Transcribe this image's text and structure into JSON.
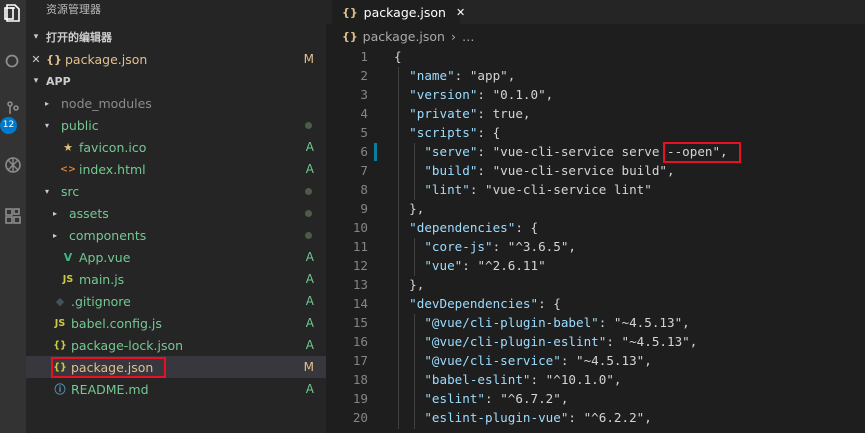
{
  "explorer": {
    "title": "资源管理器",
    "open_editors": {
      "header": "打开的编辑器",
      "items": [
        {
          "name": "package.json",
          "status": "M",
          "close_glyph": "✕",
          "icon": "braces-icon"
        }
      ]
    },
    "folder": {
      "header": "APP",
      "items": [
        {
          "name": "node_modules",
          "icon": "",
          "twisty": "▸",
          "status": "",
          "indent": 1
        },
        {
          "name": "public",
          "icon": "",
          "twisty": "▾",
          "status": "dot",
          "indent": 1
        },
        {
          "name": "favicon.ico",
          "icon": "★",
          "twisty": "",
          "status": "A",
          "indent": 2
        },
        {
          "name": "index.html",
          "icon": "<>",
          "twisty": "",
          "status": "A",
          "indent": 2
        },
        {
          "name": "src",
          "icon": "",
          "twisty": "▾",
          "status": "dot",
          "indent": 1
        },
        {
          "name": "assets",
          "icon": "",
          "twisty": "▸",
          "status": "dot",
          "indent": 2
        },
        {
          "name": "components",
          "icon": "",
          "twisty": "▸",
          "status": "dot",
          "indent": 2
        },
        {
          "name": "App.vue",
          "icon": "V",
          "twisty": "",
          "status": "A",
          "indent": 2
        },
        {
          "name": "main.js",
          "icon": "JS",
          "twisty": "",
          "status": "A",
          "indent": 2
        },
        {
          "name": ".gitignore",
          "icon": "◆",
          "twisty": "",
          "status": "A",
          "indent": 1
        },
        {
          "name": "babel.config.js",
          "icon": "JS",
          "twisty": "",
          "status": "A",
          "indent": 1
        },
        {
          "name": "package-lock.json",
          "icon": "{}",
          "twisty": "",
          "status": "A",
          "indent": 1
        },
        {
          "name": "package.json",
          "icon": "{}",
          "twisty": "",
          "status": "M",
          "indent": 1
        },
        {
          "name": "README.md",
          "icon": "ⓘ",
          "twisty": "",
          "status": "A",
          "indent": 1
        }
      ]
    }
  },
  "activity_bar": {
    "scm_badge": "12"
  },
  "tab": {
    "label": "package.json",
    "icon": "{}",
    "close_glyph": "✕"
  },
  "breadcrumb": {
    "file": "package.json",
    "sep": "›",
    "more": "…",
    "icon": "{}"
  },
  "editor": {
    "lines": [
      {
        "n": "1",
        "code": "{"
      },
      {
        "n": "2",
        "code": "  \"name\": \"app\","
      },
      {
        "n": "3",
        "code": "  \"version\": \"0.1.0\","
      },
      {
        "n": "4",
        "code": "  \"private\": true,"
      },
      {
        "n": "5",
        "code": "  \"scripts\": {"
      },
      {
        "n": "6",
        "code": "    \"serve\": \"vue-cli-service serve --open\","
      },
      {
        "n": "7",
        "code": "    \"build\": \"vue-cli-service build\","
      },
      {
        "n": "8",
        "code": "    \"lint\": \"vue-cli-service lint\""
      },
      {
        "n": "9",
        "code": "  },"
      },
      {
        "n": "10",
        "code": "  \"dependencies\": {"
      },
      {
        "n": "11",
        "code": "    \"core-js\": \"^3.6.5\","
      },
      {
        "n": "12",
        "code": "    \"vue\": \"^2.6.11\""
      },
      {
        "n": "13",
        "code": "  },"
      },
      {
        "n": "14",
        "code": "  \"devDependencies\": {"
      },
      {
        "n": "15",
        "code": "    \"@vue/cli-plugin-babel\": \"~4.5.13\","
      },
      {
        "n": "16",
        "code": "    \"@vue/cli-plugin-eslint\": \"~4.5.13\","
      },
      {
        "n": "17",
        "code": "    \"@vue/cli-service\": \"~4.5.13\","
      },
      {
        "n": "18",
        "code": "    \"babel-eslint\": \"^10.1.0\","
      },
      {
        "n": "19",
        "code": "    \"eslint\": \"^6.7.2\","
      },
      {
        "n": "20",
        "code": "    \"eslint-plugin-vue\": \"^6.2.2\","
      }
    ]
  },
  "colors": {
    "accent": "#007acc",
    "highlight": "#e81123",
    "added": "#73c991",
    "modified": "#e2c08d"
  }
}
